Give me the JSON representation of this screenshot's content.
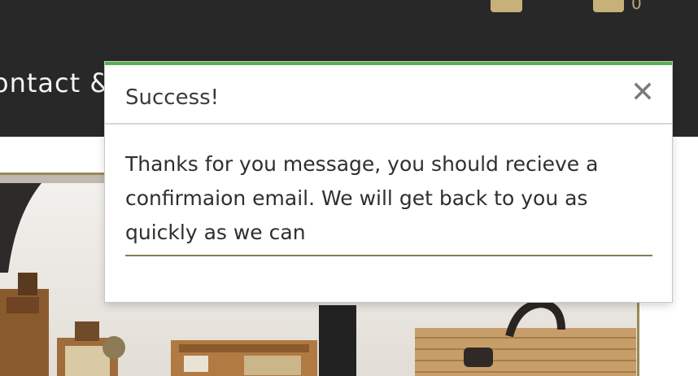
{
  "header": {
    "nav_text": "ontact &",
    "cart_count": "0"
  },
  "modal": {
    "title": "Success!",
    "message": "Thanks for you message, you should recieve a confirmaion email. We will get back to you as quickly as we can"
  },
  "colors": {
    "header_bg": "#282828",
    "accent_gold": "#c6b178",
    "success_green": "#53b151",
    "divider_olive": "#867c52"
  },
  "icons": {
    "account": "user-icon",
    "bag": "shopping-bag-icon",
    "close": "close-icon"
  }
}
